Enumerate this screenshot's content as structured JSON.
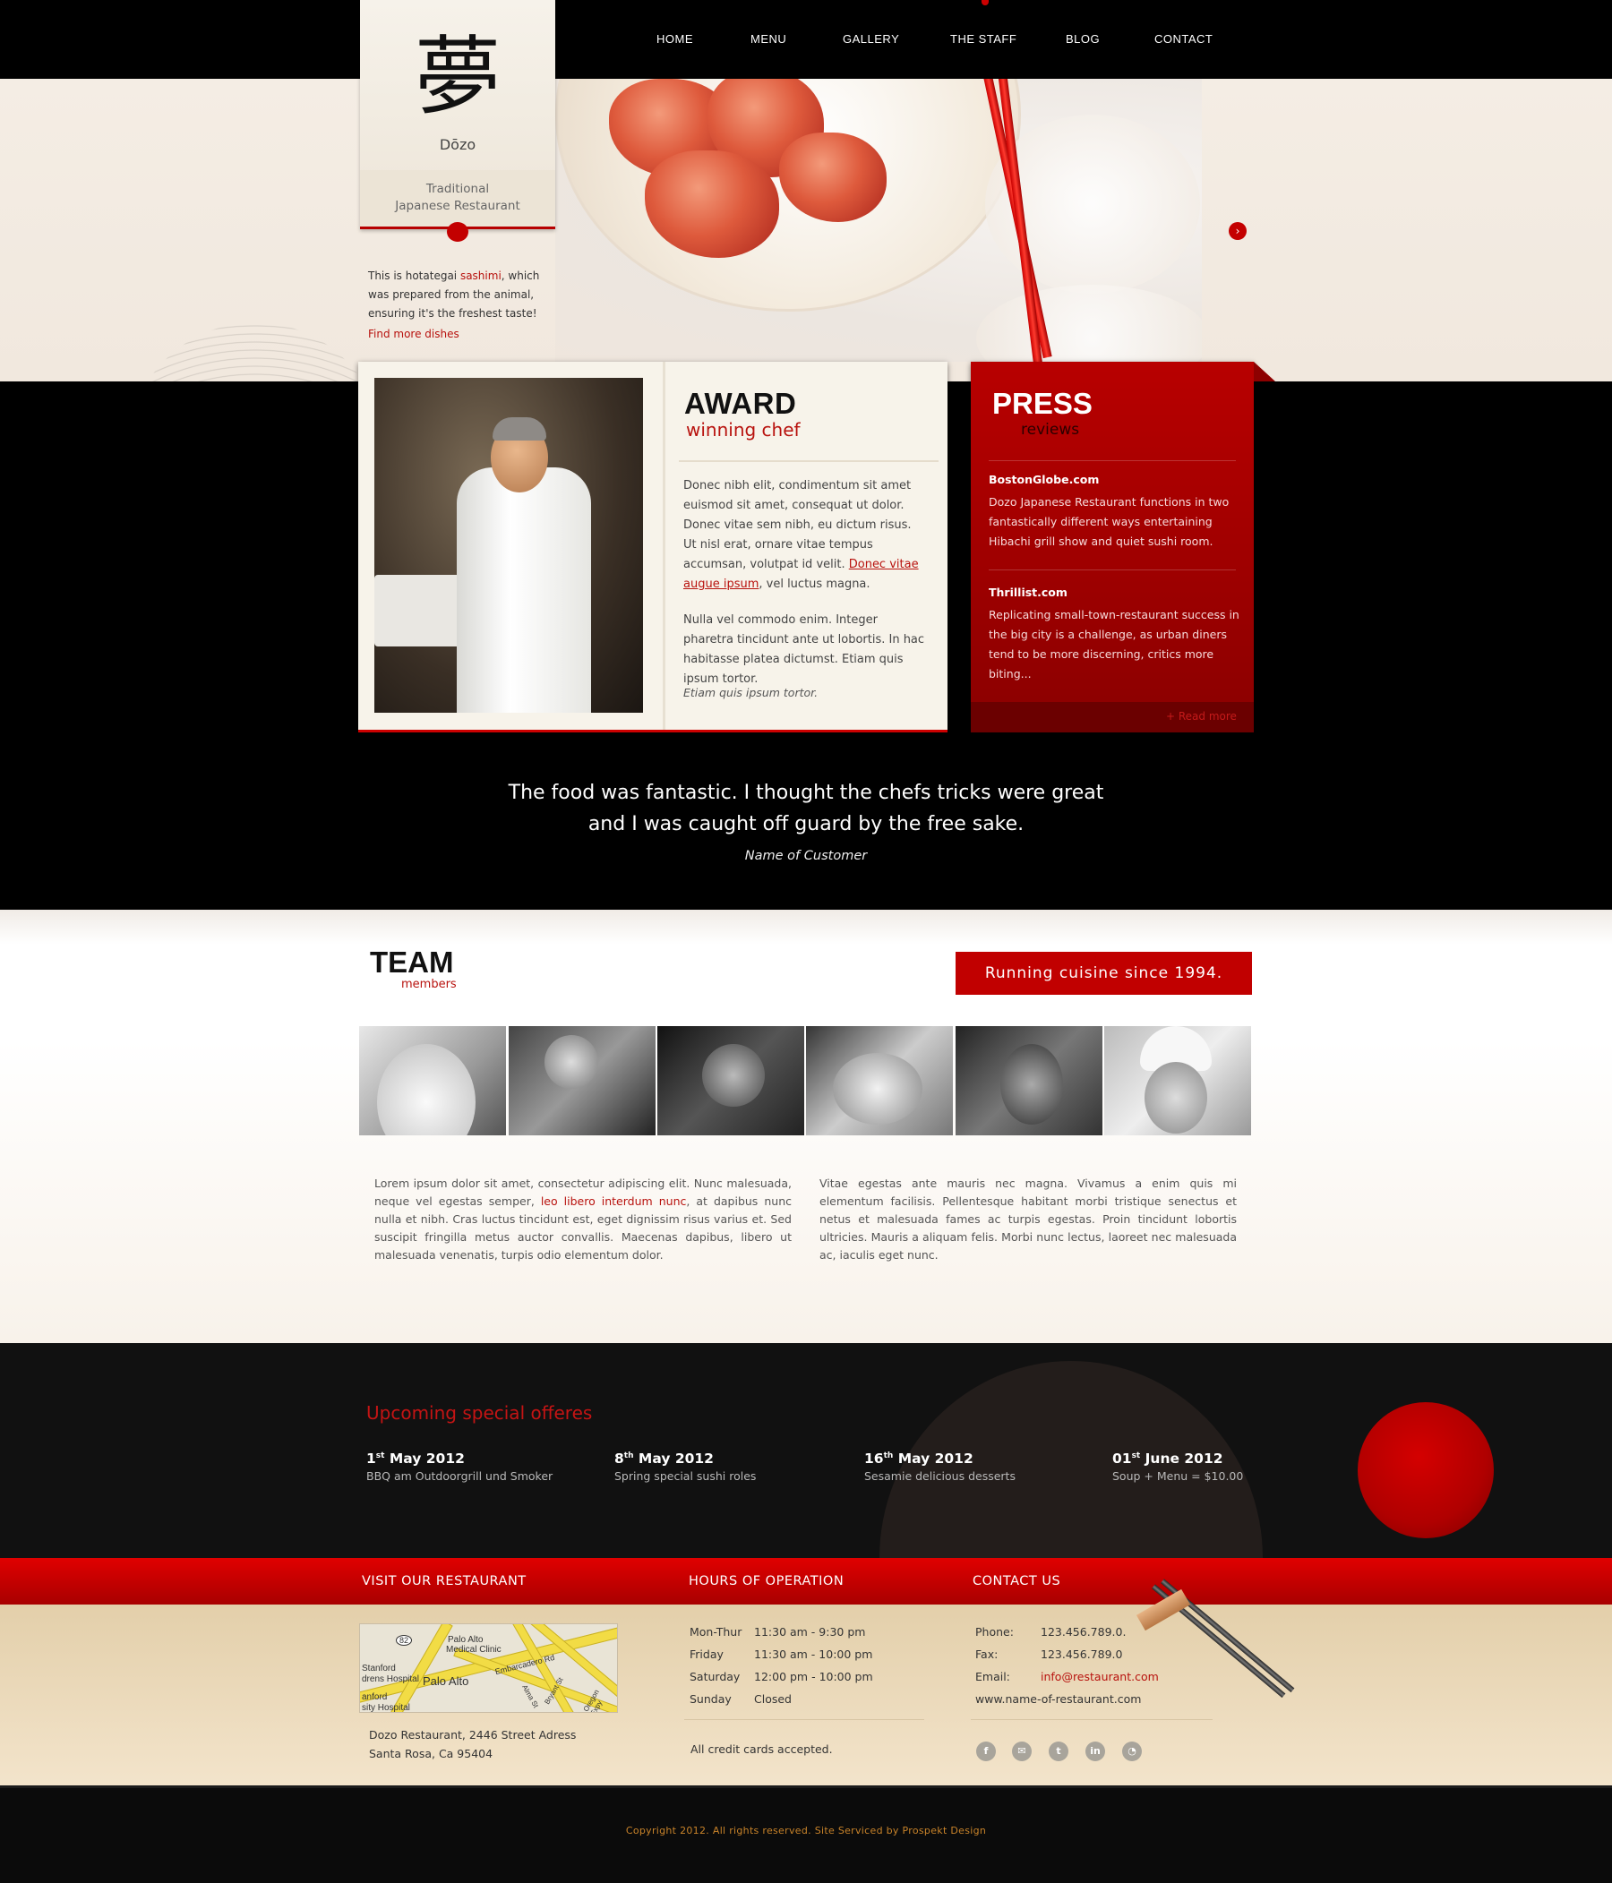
{
  "nav": {
    "items": [
      {
        "label": "HOME"
      },
      {
        "label": "MENU"
      },
      {
        "label": "GALLERY"
      },
      {
        "label": "THE STAFF"
      },
      {
        "label": "BLOG"
      },
      {
        "label": "CONTACT"
      }
    ]
  },
  "logo": {
    "glyph": "夢",
    "name": "Dōzo",
    "tagline_line1": "Traditional",
    "tagline_line2": "Japanese Restaurant"
  },
  "hero": {
    "text_before": "This is hotategai ",
    "text_link": "sashimi",
    "text_after": ", which was prepared from the animal, ensuring it's the freshest taste!",
    "find_more": "Find more dishes",
    "next_icon": "chevron-right-icon"
  },
  "award": {
    "title": "AWARD",
    "subtitle": "winning chef",
    "para1_before": "Donec nibh elit, condimentum sit amet euis­mod sit amet, consequat ut dolor. Donec vitae sem nibh, eu dictum risus. Ut nisl erat, ornare vitae tempus accumsan, volutpat id velit. ",
    "para1_link": "Donec vitae augue ipsum",
    "para1_after": ", vel luctus magna.",
    "para2": "Nulla vel commodo enim. Integer pharetra tincidunt ante ut lobortis. In hac habitasse platea dictumst. Etiam quis ipsum tortor.",
    "sign": "Etiam quis ipsum tortor."
  },
  "press": {
    "title": "PRESS",
    "subtitle": "reviews",
    "items": [
      {
        "source": "BostonGlobe.com",
        "text": "Dozo Japanese Restaurant functions in two fantastically different ways entertaining Hibachi grill show and quiet sushi room."
      },
      {
        "source": "Thrillist.com",
        "text": "Replicating small-town-restaurant success in the big city is a challenge, as urban diners tend to be more discerning, critics more biting..."
      }
    ],
    "read_more": "+ Read more"
  },
  "testimonial": {
    "line1": "The food was fantastic. I thought the chefs tricks were great",
    "line2": "and I was caught off guard by the free sake.",
    "name": "Name of Customer"
  },
  "team": {
    "title": "TEAM",
    "subtitle": "members",
    "banner": "Running cuisine since 1994.",
    "col1_before": "Lorem ipsum dolor sit amet, consectetur adipiscing elit. Nunc malesuada, neque vel egestas semper, ",
    "col1_link": "leo libero interdum nunc",
    "col1_after": ", at dapibus nunc nulla et nibh. Cras luctus tincidunt est, eget dignissim risus varius et. Sed suscipit frin­gilla metus auctor convallis. Maecenas dapibus, libero ut malesuada venena­tis, turpis odio elementum dolor.",
    "col2": "Vitae egestas ante mauris nec magna. Vivamus a enim quis mi elementum facilisis. Pellentesque habitant morbi tristique senectus et netus et male­suada fames ac turpis egestas. Proin tincidunt lobortis ultricies. Mauris a aliquam felis. Morbi nunc lectus, laoreet nec malesuada ac, iaculis eget nunc."
  },
  "specials": {
    "title": "Upcoming special offeres",
    "offers": [
      {
        "day": "1",
        "suffix": "st",
        "month": " May 2012",
        "desc": "BBQ am Outdoorgrill und Smoker"
      },
      {
        "day": "8",
        "suffix": "th",
        "month": " May 2012",
        "desc": "Spring special sushi roles"
      },
      {
        "day": "16",
        "suffix": "th",
        "month": " May 2012",
        "desc": "Sesamie delicious desserts"
      },
      {
        "day": "01",
        "suffix": "st",
        "month": " June 2012",
        "desc": "Soup + Menu = $10.00"
      }
    ]
  },
  "footer": {
    "visit_title": "VISIT OUR RESTAURANT",
    "hours_title": "HOURS OF OPERATION",
    "contact_title": "CONTACT US",
    "map_labels": {
      "badge": "82",
      "clinic1": "Palo Alto",
      "clinic2": "Medical Clinic",
      "road1": "Embarcadero Rd",
      "city": "Palo Alto",
      "stanford1": "Stanford",
      "stanford2": "drens Hospital",
      "stanford3": "anford",
      "stanford4": "sity Hospital",
      "road2": "Alma St",
      "road3": "Bryant St",
      "road4": "Oregon Expy"
    },
    "address_line1": "Dozo Restaurant, 2446 Street Adress",
    "address_line2": "Santa Rosa, Ca 95404",
    "hours": [
      {
        "day": "Mon-Thur",
        "time": "11:30 am -  9:30 pm"
      },
      {
        "day": "Friday",
        "time": "11:30 am - 10:00 pm"
      },
      {
        "day": "Saturday",
        "time": "12:00 pm - 10:00 pm"
      },
      {
        "day": "Sunday",
        "time": "Closed"
      }
    ],
    "credit_note": "All credit cards accepted.",
    "contact": {
      "phone_label": "Phone:",
      "phone": "123.456.789.0.",
      "fax_label": "Fax:",
      "fax": "123.456.789.0",
      "email_label": "Email:",
      "email": "info@restaurant.com",
      "web": "www.name-of-restaurant.com"
    },
    "social": [
      "facebook-icon",
      "email-icon",
      "twitter-icon",
      "linkedin-icon",
      "rss-icon"
    ],
    "copyright": "Copyright 2012. All rights reserved. Site Serviced by Prospekt Design"
  }
}
